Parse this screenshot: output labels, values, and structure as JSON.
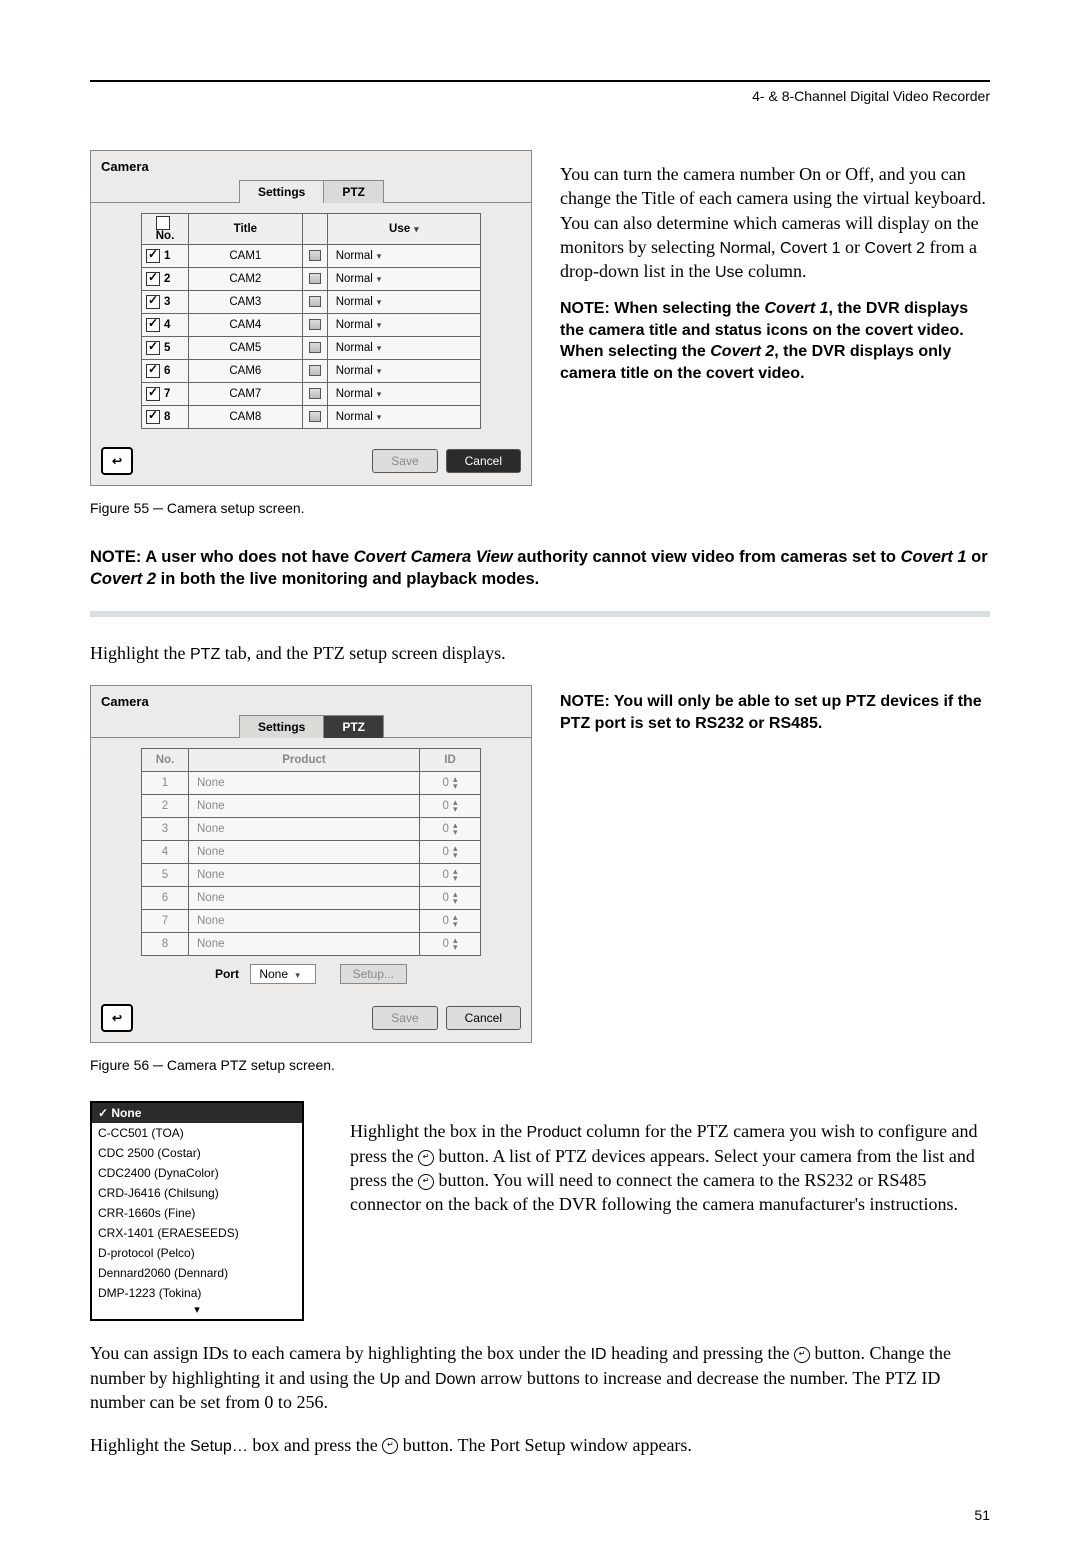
{
  "header": {
    "title": "4- & 8-Channel Digital Video Recorder"
  },
  "fig55": {
    "panel_title": "Camera",
    "tabs": {
      "settings": "Settings",
      "ptz": "PTZ"
    },
    "cols": {
      "no": "No.",
      "title": "Title",
      "use": "Use"
    },
    "rows": [
      {
        "n": "1",
        "title": "CAM1",
        "use": "Normal"
      },
      {
        "n": "2",
        "title": "CAM2",
        "use": "Normal"
      },
      {
        "n": "3",
        "title": "CAM3",
        "use": "Normal"
      },
      {
        "n": "4",
        "title": "CAM4",
        "use": "Normal"
      },
      {
        "n": "5",
        "title": "CAM5",
        "use": "Normal"
      },
      {
        "n": "6",
        "title": "CAM6",
        "use": "Normal"
      },
      {
        "n": "7",
        "title": "CAM7",
        "use": "Normal"
      },
      {
        "n": "8",
        "title": "CAM8",
        "use": "Normal"
      }
    ],
    "save": "Save",
    "cancel": "Cancel",
    "caption": "Figure 55 ─ Camera setup screen."
  },
  "text1": {
    "p1a": "You can turn the camera number On or Off, and you can change the Title of each camera using the virtual keyboard.  You can also determine which cameras will display on the monitors by selecting ",
    "normal": "Normal",
    "p1b": ", ",
    "covert1": "Covert 1",
    "p1c": " or ",
    "covert2": "Covert 2",
    "p1d": " from a drop-down list in the ",
    "use": "Use",
    "p1e": " column.",
    "note": "NOTE:  When selecting the ",
    "cov1i": "Covert 1",
    "note2": ", the DVR displays the camera title and status icons on the covert video.  When selecting the ",
    "cov2i": "Covert 2",
    "note3": ", the DVR displays only camera title on the covert video."
  },
  "note_full": {
    "a": "NOTE:  A user who does not have ",
    "b": "Covert Camera View",
    "c": " authority cannot view video from cameras set to ",
    "d": "Covert 1",
    "e": " or ",
    "f": "Covert 2",
    "g": " in both the live monitoring and playback modes."
  },
  "ptz_intro_a": "Highlight the ",
  "ptz_intro_b": "PTZ",
  "ptz_intro_c": " tab, and the PTZ setup screen displays.",
  "fig56": {
    "panel_title": "Camera",
    "tabs": {
      "settings": "Settings",
      "ptz": "PTZ"
    },
    "cols": {
      "no": "No.",
      "product": "Product",
      "id": "ID"
    },
    "rows": [
      {
        "n": "1",
        "product": "None",
        "id": "0"
      },
      {
        "n": "2",
        "product": "None",
        "id": "0"
      },
      {
        "n": "3",
        "product": "None",
        "id": "0"
      },
      {
        "n": "4",
        "product": "None",
        "id": "0"
      },
      {
        "n": "5",
        "product": "None",
        "id": "0"
      },
      {
        "n": "6",
        "product": "None",
        "id": "0"
      },
      {
        "n": "7",
        "product": "None",
        "id": "0"
      },
      {
        "n": "8",
        "product": "None",
        "id": "0"
      }
    ],
    "port_label": "Port",
    "port_val": "None",
    "setup": "Setup...",
    "save": "Save",
    "cancel": "Cancel",
    "caption": "Figure 56 ─ Camera PTZ setup screen."
  },
  "ptz_note": {
    "a": "NOTE:  You will only be able to set up PTZ devices if the PTZ port is set to RS232 or RS485."
  },
  "ptz_list": {
    "sel": "None",
    "items": [
      "C-CC501 (TOA)",
      "CDC 2500 (Costar)",
      "CDC2400 (DynaColor)",
      "CRD-J6416 (Chilsung)",
      "CRR-1660s (Fine)",
      "CRX-1401 (ERAESEEDS)",
      "D-protocol (Pelco)",
      "Dennard2060 (Dennard)",
      "DMP-1223 (Tokina)"
    ]
  },
  "text3": {
    "p1a": "Highlight the box in the ",
    "product": "Product",
    "p1b": " column for the PTZ camera you wish to configure and press the ",
    "p1c": " button.  A list of PTZ devices appears. Select your camera from the list and press the ",
    "p1d": " button.  You will need to connect the camera to the RS232 or RS485 connector on the back of the DVR following the camera manufacturer's instructions."
  },
  "text4": {
    "a": "You can assign IDs to each camera by highlighting the box under the ",
    "id": "ID",
    "b": " heading and pressing the ",
    "c": " button.  Change the number by highlighting it and using the ",
    "up": "Up",
    "d": " and ",
    "down": "Down",
    "e": " arrow buttons to increase and decrease the number.  The PTZ ID number can be set from 0 to 256."
  },
  "text5": {
    "a": "Highlight the ",
    "setup": "Setup…",
    "b": " box and press the ",
    "c": " button.  The Port Setup window appears."
  },
  "page_num": "51",
  "icons": {
    "check_prefix": "✓ ",
    "enter": "↵",
    "back": "↩",
    "down_caret": "▾",
    "spinner": "▴▾"
  }
}
